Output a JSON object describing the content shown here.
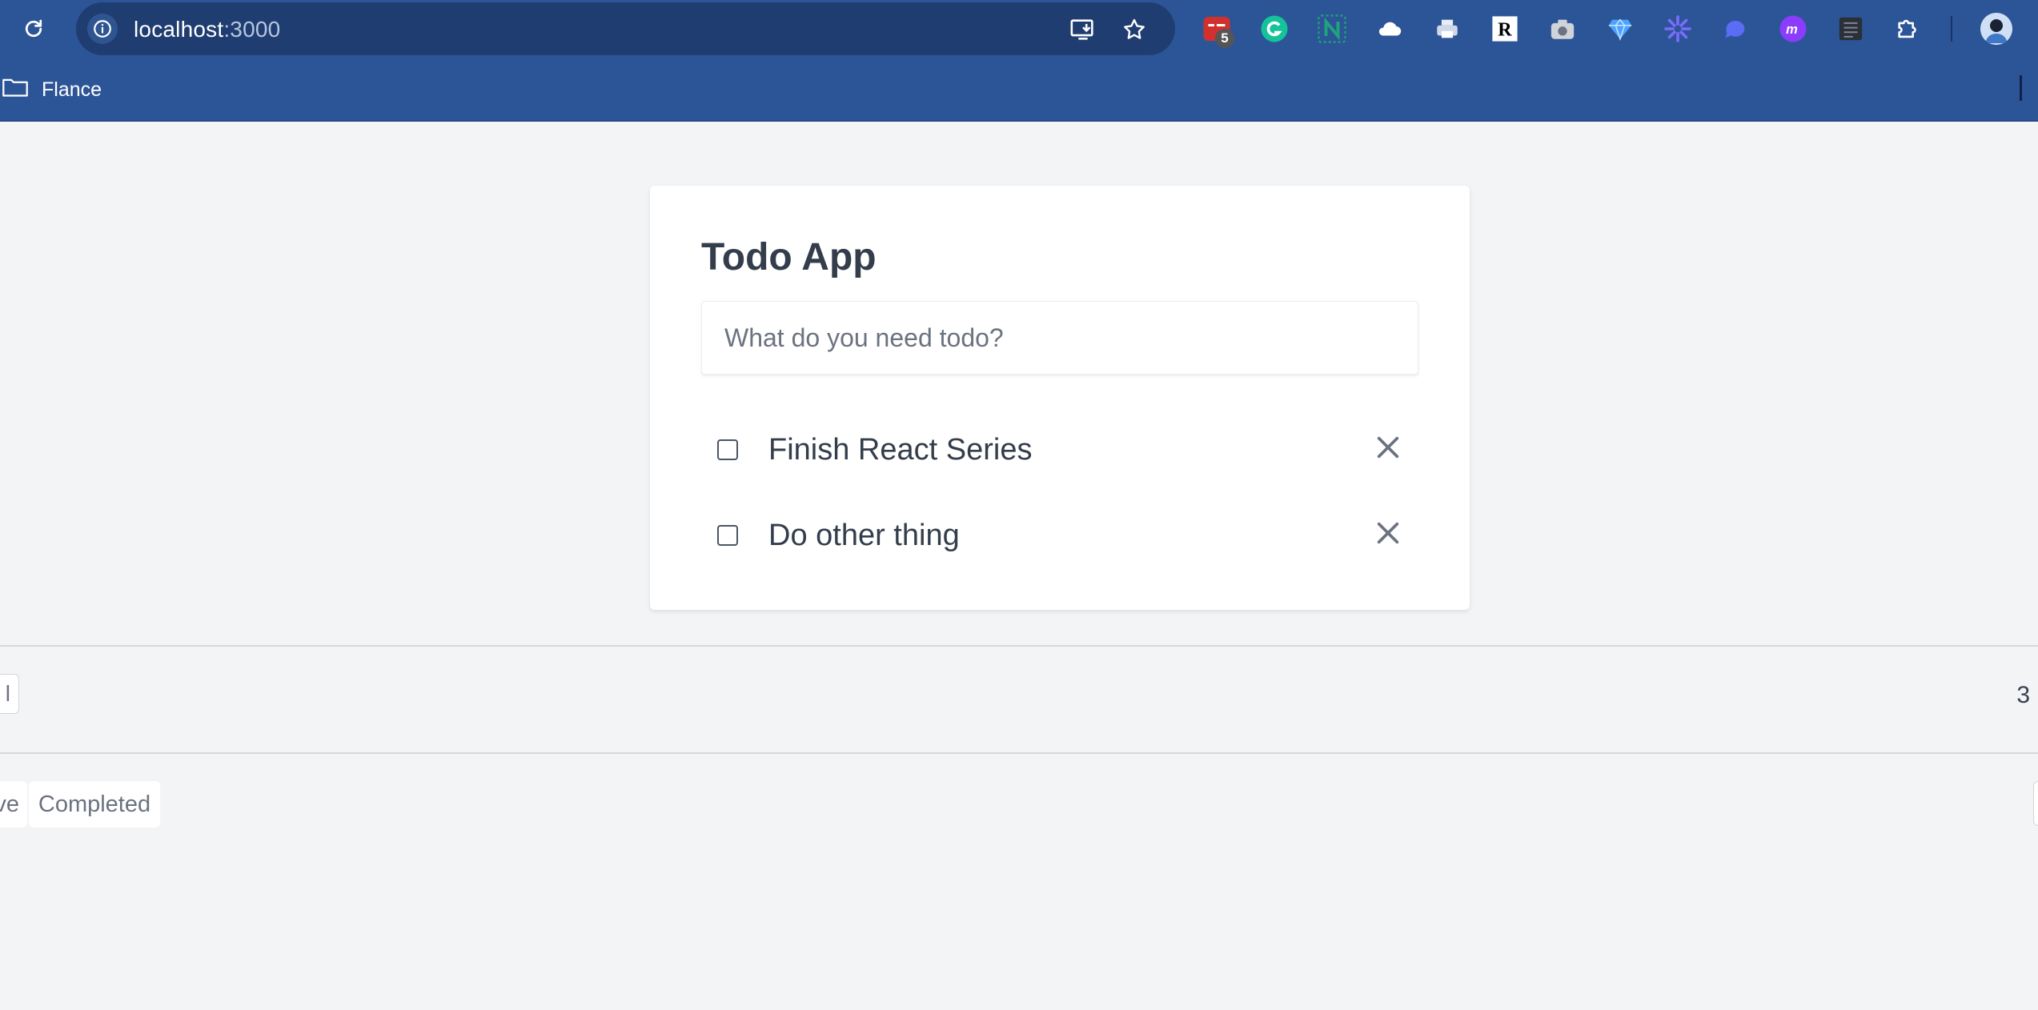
{
  "browser": {
    "url_host": "localhost",
    "url_port": ":3000",
    "extensions": [
      {
        "name": "todoist-extension-icon",
        "color": "#d0312d",
        "badge": "5"
      },
      {
        "name": "grammarly-extension-icon",
        "color": "#15c39a"
      },
      {
        "name": "notion-extension-icon",
        "color": "#1fa37c"
      },
      {
        "name": "cloud-extension-icon",
        "color": "#ffffff"
      },
      {
        "name": "printer-extension-icon",
        "color": "#cfd8e8"
      },
      {
        "name": "readwise-extension-icon",
        "color": "#000000"
      },
      {
        "name": "camera-extension-icon",
        "color": "#cfd3da"
      },
      {
        "name": "gem-extension-icon",
        "color": "#4aa3ff"
      },
      {
        "name": "sparkle-extension-icon",
        "color": "#7b6cff"
      },
      {
        "name": "chat-extension-icon",
        "color": "#5b6cf5"
      },
      {
        "name": "m-extension-icon",
        "color": "#8b3cff"
      },
      {
        "name": "reader-extension-icon",
        "color": "#2a2f38"
      },
      {
        "name": "puzzle-extensions-icon",
        "color": "#ffffff"
      }
    ],
    "bookmark_folder": "Flance"
  },
  "app": {
    "title": "Todo App",
    "input_placeholder": "What do you need todo?",
    "input_value": "",
    "todos": [
      {
        "text": "Finish React Series",
        "done": false
      },
      {
        "text": "Do other thing",
        "done": false
      }
    ]
  },
  "footer": {
    "left_button_fragment": "l",
    "count": "3",
    "filter_partial": "ve",
    "filter_completed": "Completed"
  }
}
